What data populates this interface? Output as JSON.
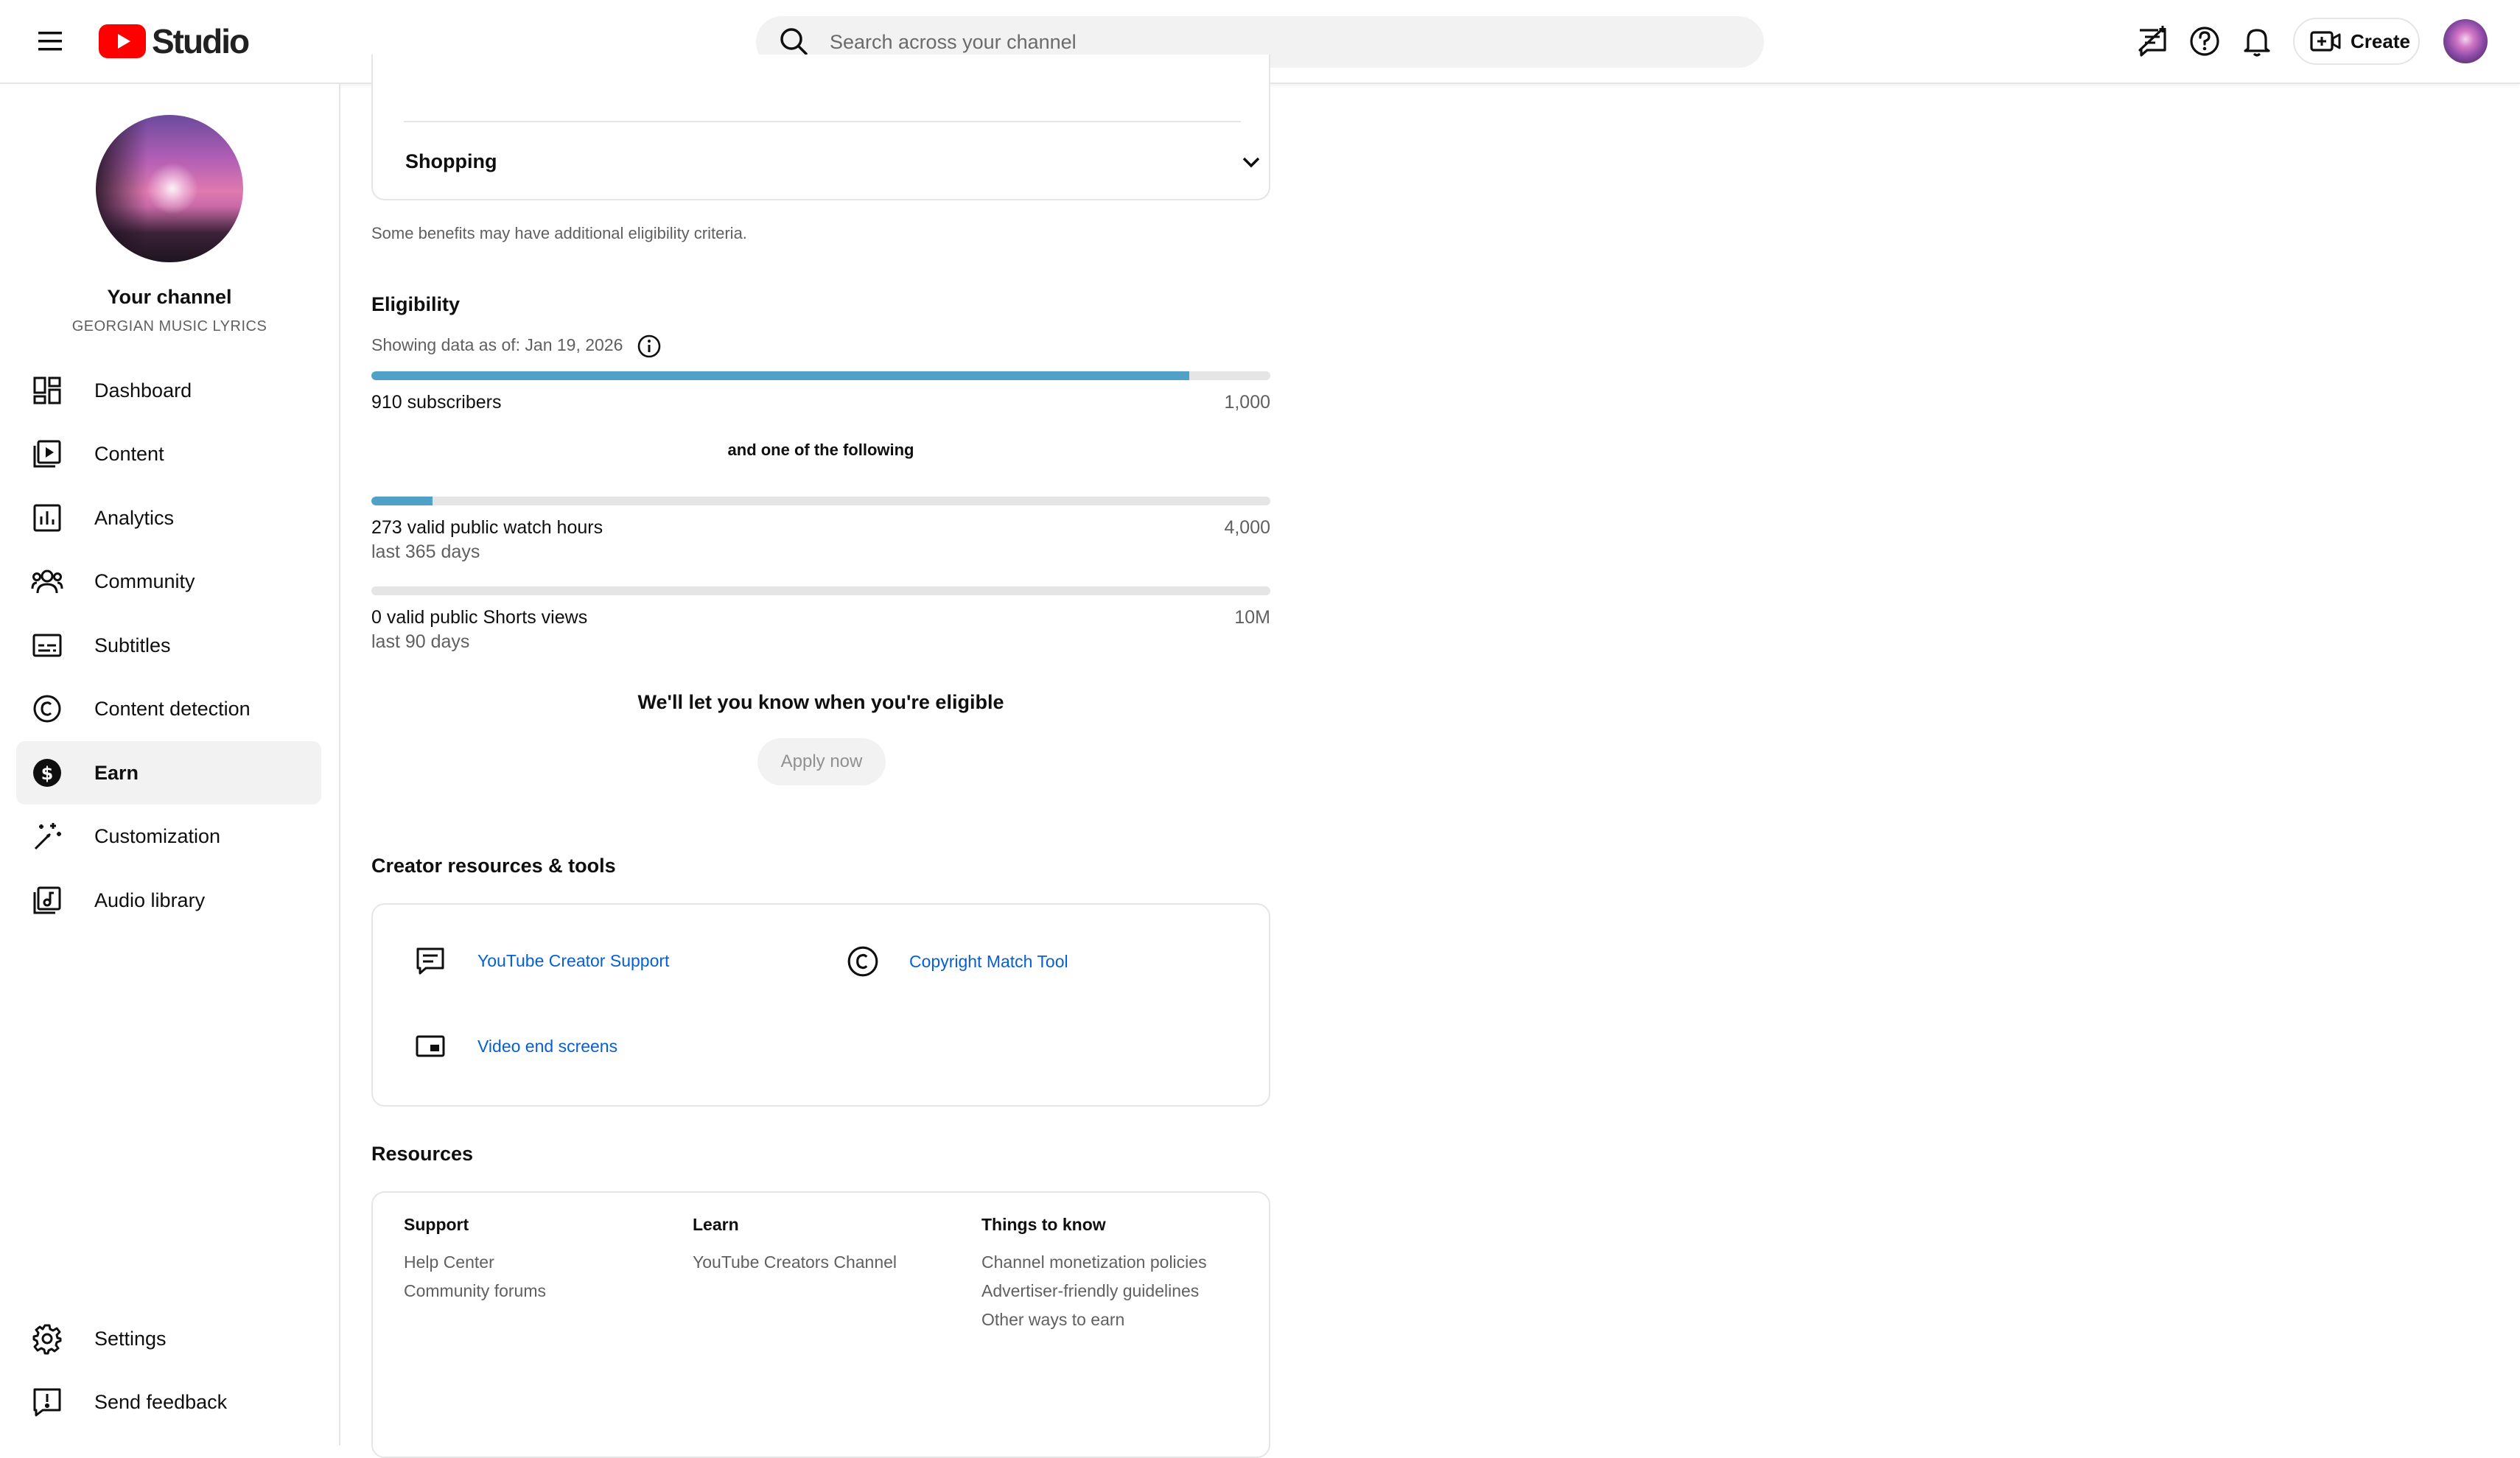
{
  "header": {
    "logo_text": "Studio",
    "search_placeholder": "Search across your channel",
    "create_label": "Create",
    "icons": [
      "hamburger-menu-icon",
      "youtube-logo-icon",
      "search-icon",
      "feedback-chat-icon",
      "help-icon",
      "notifications-bell-icon",
      "create-video-icon"
    ]
  },
  "sidebar": {
    "channel_title": "Your channel",
    "channel_name": "GEORGIAN MUSIC LYRICS",
    "items": [
      {
        "label": "Dashboard",
        "icon": "dashboard-icon"
      },
      {
        "label": "Content",
        "icon": "content-icon"
      },
      {
        "label": "Analytics",
        "icon": "analytics-icon"
      },
      {
        "label": "Community",
        "icon": "community-icon"
      },
      {
        "label": "Subtitles",
        "icon": "subtitles-icon"
      },
      {
        "label": "Content detection",
        "icon": "copyright-icon"
      },
      {
        "label": "Earn",
        "icon": "dollar-icon",
        "active": true
      },
      {
        "label": "Customization",
        "icon": "magic-wand-icon"
      },
      {
        "label": "Audio library",
        "icon": "audio-library-icon"
      }
    ],
    "bottom_items": [
      {
        "label": "Settings",
        "icon": "gear-icon"
      },
      {
        "label": "Send feedback",
        "icon": "feedback-icon"
      }
    ]
  },
  "main": {
    "shopping_label": "Shopping",
    "benefits_note": "Some benefits may have additional eligibility criteria.",
    "eligibility": {
      "title": "Eligibility",
      "data_date": "Showing data as of: Jan 19, 2026",
      "subscribers": {
        "label": "910 subscribers",
        "target": "1,000",
        "progress": 0.91
      },
      "connector": "and one of the following",
      "watch_hours": {
        "label": "273 valid public watch hours",
        "sub": "last 365 days",
        "target": "4,000",
        "progress": 0.068
      },
      "shorts_views": {
        "label": "0 valid public Shorts views",
        "sub": "last 90 days",
        "target": "10M",
        "progress": 0
      },
      "notify_text": "We'll let you know when you're eligible",
      "apply_label": "Apply now"
    },
    "creator_tools": {
      "title": "Creator resources & tools",
      "links": [
        {
          "label": "YouTube Creator Support",
          "icon": "support-chat-icon"
        },
        {
          "label": "Copyright Match Tool",
          "icon": "copyright-icon"
        },
        {
          "label": "Video end screens",
          "icon": "end-screen-icon"
        }
      ]
    },
    "resources": {
      "title": "Resources",
      "columns": [
        {
          "heading": "Support",
          "links": [
            "Help Center",
            "Community forums"
          ]
        },
        {
          "heading": "Learn",
          "links": [
            "YouTube Creators Channel"
          ]
        },
        {
          "heading": "Things to know",
          "links": [
            "Channel monetization policies",
            "Advertiser-friendly guidelines",
            "Other ways to earn"
          ]
        }
      ]
    }
  },
  "colors": {
    "accent": "#ff0000",
    "progress": "#4fa1c8",
    "link": "#065fd4",
    "active_bg": "#f2f2f2"
  }
}
